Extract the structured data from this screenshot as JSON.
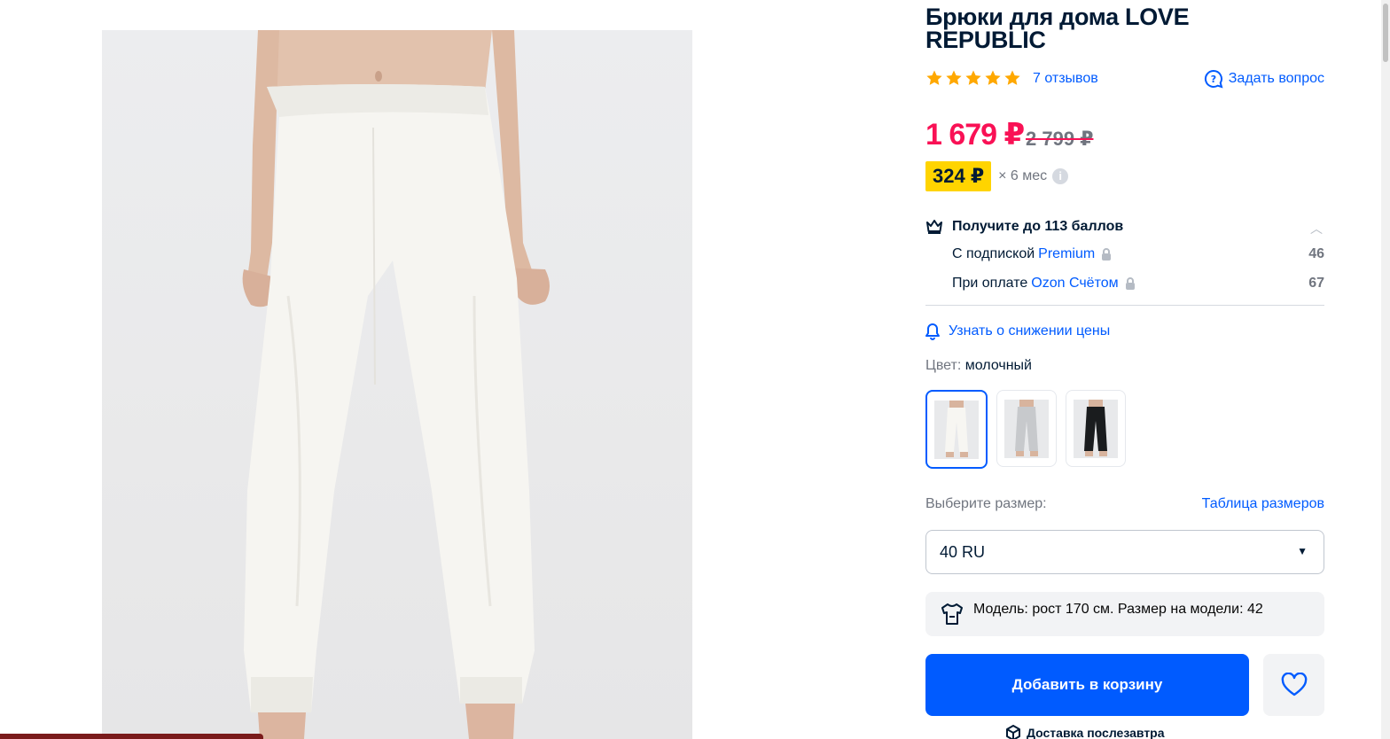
{
  "product": {
    "title": "Брюки для дома LOVE REPUBLIC",
    "reviews_link": "7 отзывов",
    "ask_question": "Задать вопрос",
    "rating": 5,
    "price_current": "1 679 ₽",
    "price_old": "2 799 ₽",
    "installment_amount": "324 ₽",
    "installment_term": "× 6 мес"
  },
  "bonus": {
    "title": "Получите до 113 баллов",
    "line1_prefix": "С подпиской",
    "line1_accent": "Premium",
    "line1_value": "46",
    "line2_prefix": "При оплате",
    "line2_accent": "Ozon Счётом",
    "line2_value": "67"
  },
  "price_alert": "Узнать о снижении цены",
  "color": {
    "label": "Цвет:",
    "value": "молочный",
    "swatches": [
      "milk",
      "grey",
      "black"
    ]
  },
  "size": {
    "label": "Выберите размер:",
    "table_link": "Таблица размеров",
    "selected": "40 RU"
  },
  "model_info": "Модель: рост 170 см. Размер на модели: 42",
  "actions": {
    "add_to_cart": "Добавить в корзину",
    "delivery": "Доставка послезавтра"
  },
  "colors": {
    "accent": "#005bff",
    "price": "#f91155",
    "installment_bg": "#ffd400",
    "star": "#ffa800"
  }
}
